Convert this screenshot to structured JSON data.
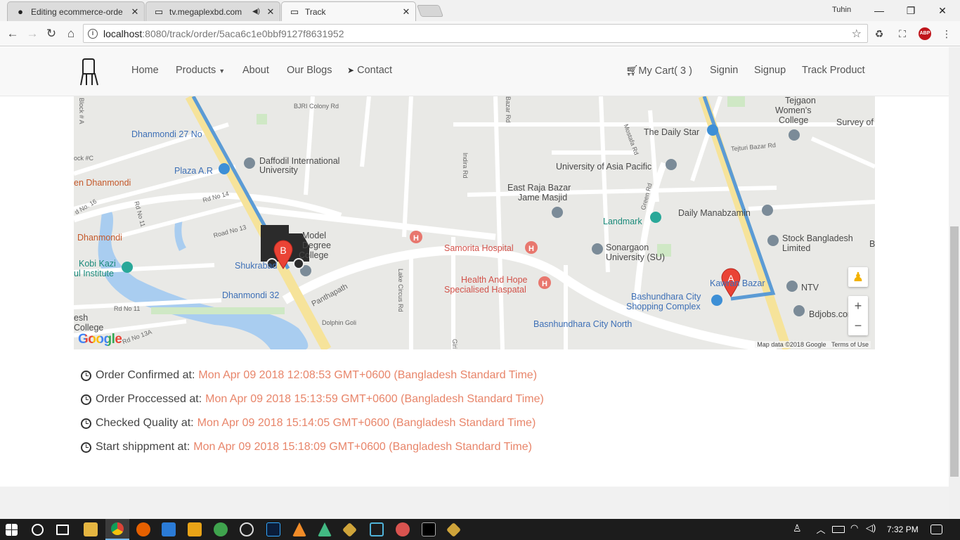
{
  "browser": {
    "tabs": [
      {
        "title": "Editing ecommerce-orde",
        "icon": "github-icon",
        "active": false
      },
      {
        "title": "tv.megaplexbd.com",
        "icon": "page-icon",
        "active": false,
        "audio": true
      },
      {
        "title": "Track",
        "icon": "page-icon",
        "active": true
      }
    ],
    "user": "Tuhin",
    "url_host": "localhost",
    "url_rest": ":8080/track/order/5aca6c1e0bbf9127f8631952"
  },
  "nav": {
    "home": "Home",
    "products": "Products",
    "about": "About",
    "blogs": "Our Blogs",
    "contact": "Contact",
    "cart": "My Cart( 3 )",
    "signin": "Signin",
    "signup": "Signup",
    "track": "Track Product"
  },
  "map": {
    "labels": {
      "dhanmondi27": "Dhanmondi 27 No",
      "plaza": "Plaza A.R",
      "daffodil1": "Daffodil International",
      "daffodil2": "University",
      "enDhanmondi": "en Dhanmondi",
      "dhanmondi": "Dhanmondi",
      "model1": "Model",
      "model2": "Degree",
      "model3": "College",
      "shukrabad": "Shukrabad",
      "kobi1": "Kobi Kazi",
      "kobi2": "ul Institute",
      "dhanmondi32": "Dhanmondi 32",
      "esh1": "esh",
      "esh2": "College",
      "samorita": "Samorita Hospital",
      "health1": "Health And Hope",
      "health2": "Specialised Haspatal",
      "eastRaja1": "East Raja Bazar",
      "eastRaja2": "Jame Masjid",
      "uap": "University of Asia Pacific",
      "landmark": "Landmark",
      "sonargaon1": "Sonargaon",
      "sonargaon2": "University (SU)",
      "dailyStar": "The Daily Star",
      "tejgaon1": "Tejgaon",
      "tejgaon2": "Women's",
      "tejgaon3": "College",
      "surveyOf": "Survey of",
      "manabzamin": "Daily Manabzamin",
      "stock1": "Stock Bangladesh",
      "stock2": "Limited",
      "kawranBazar": "Kawran Bazar",
      "ntv": "NTV",
      "bashundhara1": "Bashundhara City",
      "bashundhara2": "Shopping Complex",
      "bdjobs": "Bdjobs.com",
      "bashundharaNorth": "Basnhundhara City North",
      "b": "B"
    },
    "streets": {
      "bjri": "BJRI Colony Rd",
      "block": "Block # A",
      "blockC": "ock #C",
      "rd14": "Rd No 14",
      "road13": "Road No 13",
      "rd11a": "Rd No 11",
      "rdno16": "d No. 16",
      "rd11": "Rd No 11",
      "rd13a": "Rd No 13A",
      "panthapath": "Panthapath",
      "dolphin": "Dolphin Goli",
      "lakeCircus": "Lake Circus Rd",
      "indira": "Indira Rd",
      "bazarRd": "Bazar Rd",
      "mostafa": "Mostafa Rd",
      "green": "Green Rd",
      "tejturi": "Tejturi Bazar Rd",
      "giri": "Giri"
    },
    "marker_a": "A",
    "marker_b": "B",
    "zoom_in": "+",
    "zoom_out": "−",
    "attribution": "Map data ©2018 Google",
    "terms": "Terms of Use",
    "google": "Google"
  },
  "status": [
    {
      "label": "Order Confirmed at:",
      "value": "Mon Apr 09 2018 12:08:53 GMT+0600 (Bangladesh Standard Time)"
    },
    {
      "label": "Order Proccessed at:",
      "value": "Mon Apr 09 2018 15:13:59 GMT+0600 (Bangladesh Standard Time)"
    },
    {
      "label": "Checked Quality at:",
      "value": "Mon Apr 09 2018 15:14:05 GMT+0600 (Bangladesh Standard Time)"
    },
    {
      "label": "Start shippment at:",
      "value": "Mon Apr 09 2018 15:18:09 GMT+0600 (Bangladesh Standard Time)"
    }
  ],
  "taskbar": {
    "time": "7:32 PM"
  },
  "colors": {
    "accent": "#e8856a",
    "route": "#5b9bd5",
    "highway": "#f6e39a",
    "marker": "#ea4335"
  }
}
